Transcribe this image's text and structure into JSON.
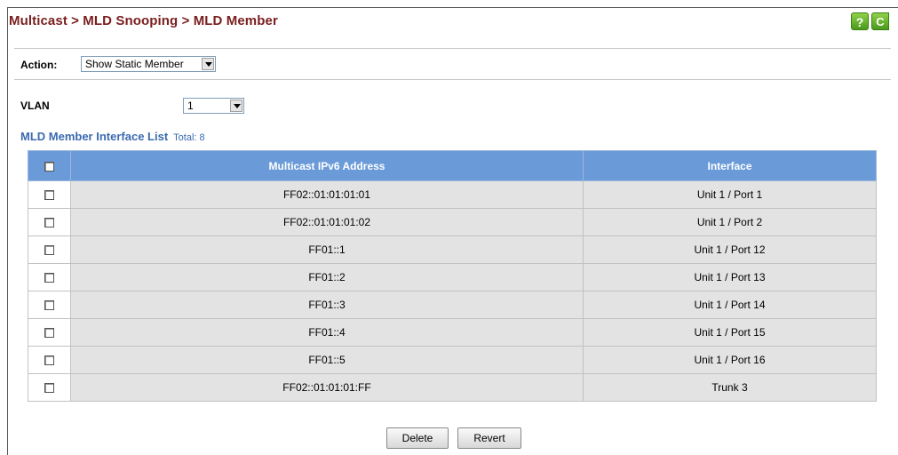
{
  "breadcrumb": "Multicast > MLD Snooping > MLD Member",
  "help_label": "?",
  "refresh_label": "C",
  "action": {
    "label": "Action:",
    "value": "Show Static Member"
  },
  "vlan": {
    "label": "VLAN",
    "value": "1"
  },
  "list": {
    "title": "MLD Member Interface List",
    "total": "Total: 8"
  },
  "table": {
    "headers": {
      "address": "Multicast IPv6 Address",
      "interface": "Interface"
    },
    "rows": [
      {
        "address": "FF02::01:01:01:01",
        "interface": "Unit 1 / Port 1"
      },
      {
        "address": "FF02::01:01:01:02",
        "interface": "Unit 1 / Port 2"
      },
      {
        "address": "FF01::1",
        "interface": "Unit 1 / Port 12"
      },
      {
        "address": "FF01::2",
        "interface": "Unit 1 / Port 13"
      },
      {
        "address": "FF01::3",
        "interface": "Unit 1 / Port 14"
      },
      {
        "address": "FF01::4",
        "interface": "Unit 1 / Port 15"
      },
      {
        "address": "FF01::5",
        "interface": "Unit 1 / Port 16"
      },
      {
        "address": "FF02::01:01:01:FF",
        "interface": "Trunk 3"
      }
    ]
  },
  "buttons": {
    "delete": "Delete",
    "revert": "Revert"
  },
  "colors": {
    "title": "#7a1e1e",
    "header": "#6a9bd8",
    "link_blue": "#3a6ab0",
    "row_bg": "#e3e3e3"
  }
}
